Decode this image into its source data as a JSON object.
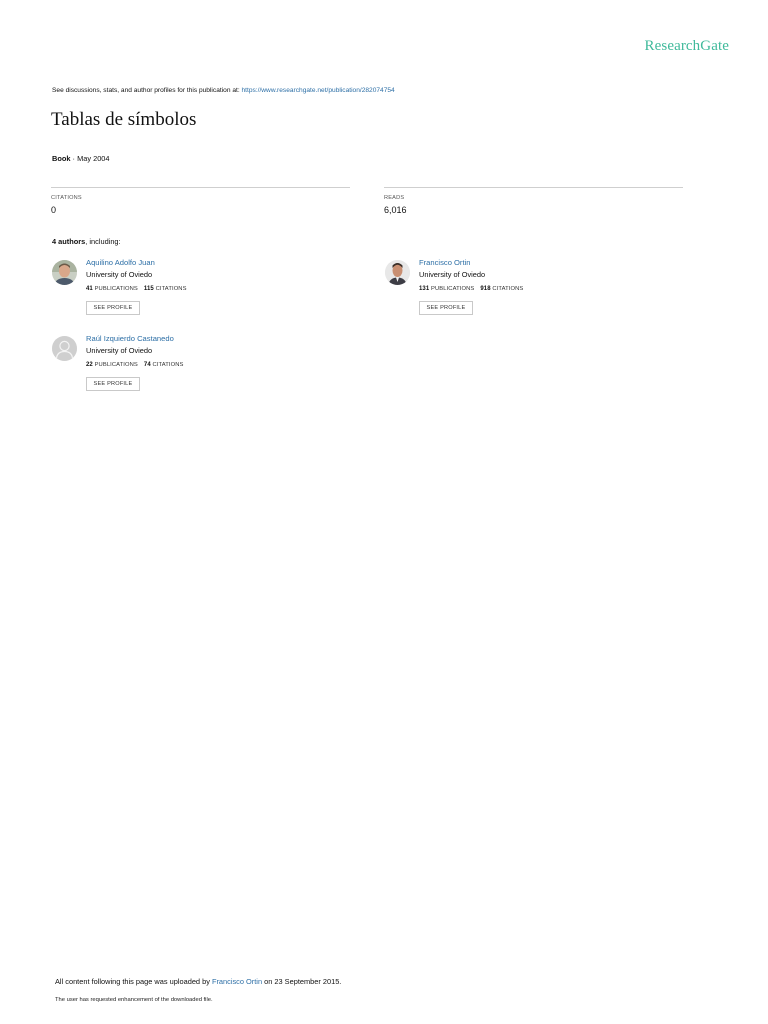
{
  "brand": {
    "logo_text": "ResearchGate",
    "accent_color": "#40ba9b",
    "link_color": "#2d6fa6"
  },
  "discussion": {
    "prefix": "See discussions, stats, and author profiles for this publication at: ",
    "url": "https://www.researchgate.net/publication/282074754"
  },
  "publication": {
    "title": "Tablas de símbolos",
    "type": "Book",
    "date_separator": " · ",
    "date": "May 2004"
  },
  "stats": {
    "citations_label": "CITATIONS",
    "citations_value": "0",
    "reads_label": "READS",
    "reads_value": "6,016"
  },
  "authors_heading": {
    "count": "4 authors",
    "suffix": ", including:"
  },
  "authors": [
    {
      "name": "Aquilino Adolfo Juan",
      "institution": "University of Oviedo",
      "publications": "41",
      "publications_label": "PUBLICATIONS",
      "citations": "115",
      "citations_label": "CITATIONS",
      "button": "SEE PROFILE",
      "avatar": "photo"
    },
    {
      "name": "Francisco Ortin",
      "institution": "University of Oviedo",
      "publications": "131",
      "publications_label": "PUBLICATIONS",
      "citations": "918",
      "citations_label": "CITATIONS",
      "button": "SEE PROFILE",
      "avatar": "photo"
    },
    {
      "name": "Raúl Izquierdo Castanedo",
      "institution": "University of Oviedo",
      "publications": "22",
      "publications_label": "PUBLICATIONS",
      "citations": "74",
      "citations_label": "CITATIONS",
      "button": "SEE PROFILE",
      "avatar": "default-user-icon"
    }
  ],
  "footer": {
    "uploaded_prefix": "All content following this page was uploaded by ",
    "uploader": "Francisco Ortin",
    "uploaded_suffix": " on 23 September 2015.",
    "enhancement_note": "The user has requested enhancement of the downloaded file."
  }
}
